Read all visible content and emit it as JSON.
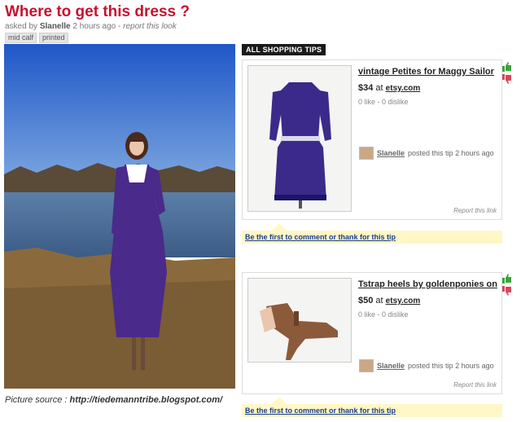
{
  "question": {
    "title": "Where to get this dress ?",
    "asked_by_prefix": "asked by",
    "user": "Slanelle",
    "time": "2 hours ago",
    "separator": "-",
    "report": "report this look",
    "tags": [
      "mid calf",
      "printed"
    ]
  },
  "source": {
    "label": "Picture source :",
    "url": "http://tiedemanntribe.blogspot.com/"
  },
  "tips_header": "ALL SHOPPING TIPS",
  "tips": [
    {
      "title": "vintage Petites for Maggy Sailor",
      "price": "$34",
      "at": "at",
      "shop": "etsy.com",
      "likes": "0 like - 0 dislike",
      "poster": "Slanelle",
      "posted_text": "posted this tip 2 hours ago",
      "report": "Report this link",
      "comment": "Be the first to comment or thank for this tip"
    },
    {
      "title": "Tstrap heels by goldenponies on",
      "price": "$50",
      "at": "at",
      "shop": "etsy.com",
      "likes": "0 like - 0 dislike",
      "poster": "Slanelle",
      "posted_text": "posted this tip 2 hours ago",
      "report": "Report this link",
      "comment": "Be the first to comment or thank for this tip"
    }
  ],
  "icons": {
    "like": "thumbs-up-icon",
    "dislike": "thumbs-down-icon"
  },
  "colors": {
    "title": "#c8102e",
    "like": "#3aa53a",
    "dislike": "#d9455a",
    "comment_bg": "#fff7c6"
  }
}
